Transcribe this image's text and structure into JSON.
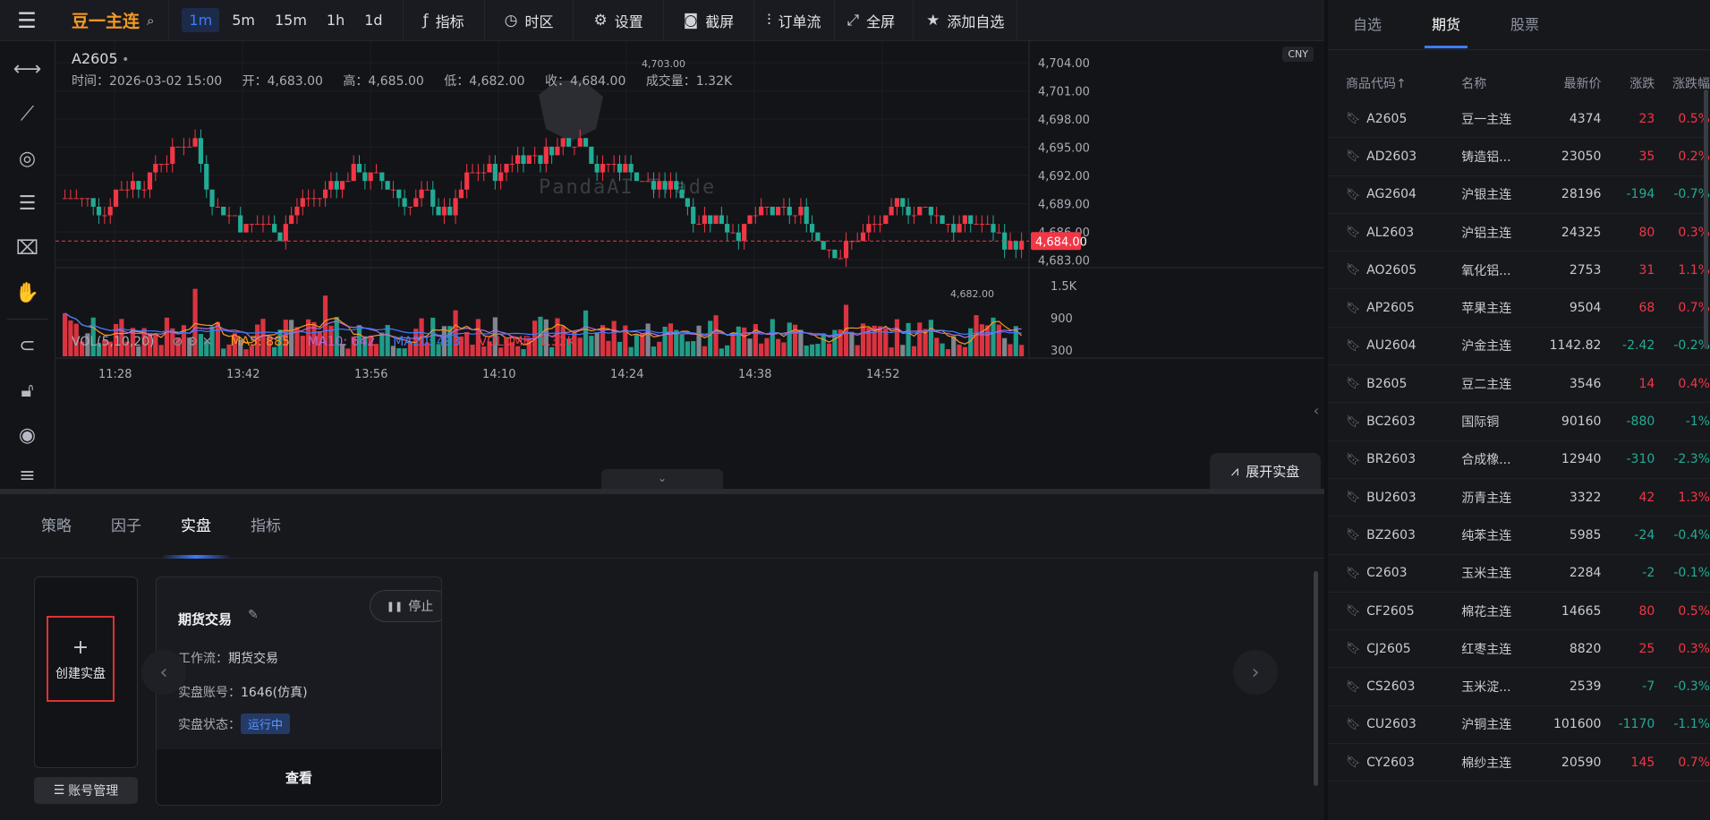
{
  "toolbar": {
    "symbol": "豆一主连",
    "timeframes": [
      "1m",
      "5m",
      "15m",
      "1h",
      "1d"
    ],
    "active_timeframe": "1m",
    "buttons": {
      "indicator": "指标",
      "timezone": "时区",
      "settings": "设置",
      "screenshot": "截屏",
      "orderflow": "订单流",
      "fullscreen": "全屏",
      "add_watch": "添加自选"
    }
  },
  "chart": {
    "symbol": "A2605",
    "ohlc": {
      "time": "时间：2026-03-02 15:00",
      "open": "开：4,683.00",
      "high": "高：4,685.00",
      "low": "低：4,682.00",
      "close": "收：4,684.00",
      "volume": "成交量：1.32K"
    },
    "currency": "CNY",
    "price_ticks": [
      "4,704.00",
      "4,701.00",
      "4,698.00",
      "4,695.00",
      "4,692.00",
      "4,689.00",
      "4,686.00",
      "4,683.00"
    ],
    "last_price": "4,684.00",
    "max_label": "4,703.00",
    "min_label": "4,682.00",
    "vol_ticks": [
      "1.5K",
      "900",
      "300"
    ],
    "time_ticks": [
      "11:28",
      "13:42",
      "13:56",
      "14:10",
      "14:24",
      "14:38",
      "14:52"
    ],
    "watermark": "PandaAI Trade",
    "vol_legend": {
      "title": "VOL(5,10,20)",
      "ma5": "MA5: 885",
      "ma10": "MA10: 642",
      "ma20": "MA20: 493",
      "volume": "VOLUME: 1.32K"
    },
    "expand_label": "展开实盘"
  },
  "chart_data": {
    "type": "candlestick",
    "price_range": [
      4681,
      4705
    ],
    "volume_range": [
      0,
      1800
    ],
    "last_close": 4684,
    "candles": [],
    "colors": {
      "up": "#f23645",
      "down": "#22ab94",
      "ma5": "#f59a23",
      "ma10": "#b26cd6",
      "ma20": "#3d7cff"
    }
  },
  "bottom": {
    "tabs": [
      "策略",
      "因子",
      "实盘",
      "指标"
    ],
    "active_tab": "实盘",
    "create_label": "创建实盘",
    "account_btn": "账号管理",
    "card": {
      "title": "期货交易",
      "stop": "停止",
      "workflow_label": "工作流：",
      "workflow": "期货交易",
      "account_label": "实盘账号：",
      "account": "1646(仿真)",
      "status_label": "实盘状态：",
      "status": "运行中",
      "view": "查看"
    }
  },
  "watchlist": {
    "tabs": [
      "自选",
      "期货",
      "股票"
    ],
    "active_tab": "期货",
    "headers": [
      "商品代码↑",
      "名称",
      "最新价",
      "涨跌",
      "涨跌幅"
    ],
    "rows": [
      [
        "A2605",
        "豆一主连",
        "4374",
        "23",
        "0.5%"
      ],
      [
        "AD2603",
        "铸造铝...",
        "23050",
        "35",
        "0.2%"
      ],
      [
        "AG2604",
        "沪银主连",
        "28196",
        "-194",
        "-0.7%"
      ],
      [
        "AL2603",
        "沪铝主连",
        "24325",
        "80",
        "0.3%"
      ],
      [
        "AO2605",
        "氧化铝...",
        "2753",
        "31",
        "1.1%"
      ],
      [
        "AP2605",
        "苹果主连",
        "9504",
        "68",
        "0.7%"
      ],
      [
        "AU2604",
        "沪金主连",
        "1142.82",
        "-2.42",
        "-0.2%"
      ],
      [
        "B2605",
        "豆二主连",
        "3546",
        "14",
        "0.4%"
      ],
      [
        "BC2603",
        "国际铜",
        "90160",
        "-880",
        "-1%"
      ],
      [
        "BR2603",
        "合成橡...",
        "12940",
        "-310",
        "-2.3%"
      ],
      [
        "BU2603",
        "沥青主连",
        "3322",
        "42",
        "1.3%"
      ],
      [
        "BZ2603",
        "纯苯主连",
        "5985",
        "-24",
        "-0.4%"
      ],
      [
        "C2603",
        "玉米主连",
        "2284",
        "-2",
        "-0.1%"
      ],
      [
        "CF2605",
        "棉花主连",
        "14665",
        "80",
        "0.5%"
      ],
      [
        "CJ2605",
        "红枣主连",
        "8820",
        "25",
        "0.3%"
      ],
      [
        "CS2603",
        "玉米淀...",
        "2539",
        "-7",
        "-0.3%"
      ],
      [
        "CU2603",
        "沪铜主连",
        "101600",
        "-1170",
        "-1.1%"
      ],
      [
        "CY2603",
        "棉纱主连",
        "20590",
        "145",
        "0.7%"
      ]
    ]
  }
}
